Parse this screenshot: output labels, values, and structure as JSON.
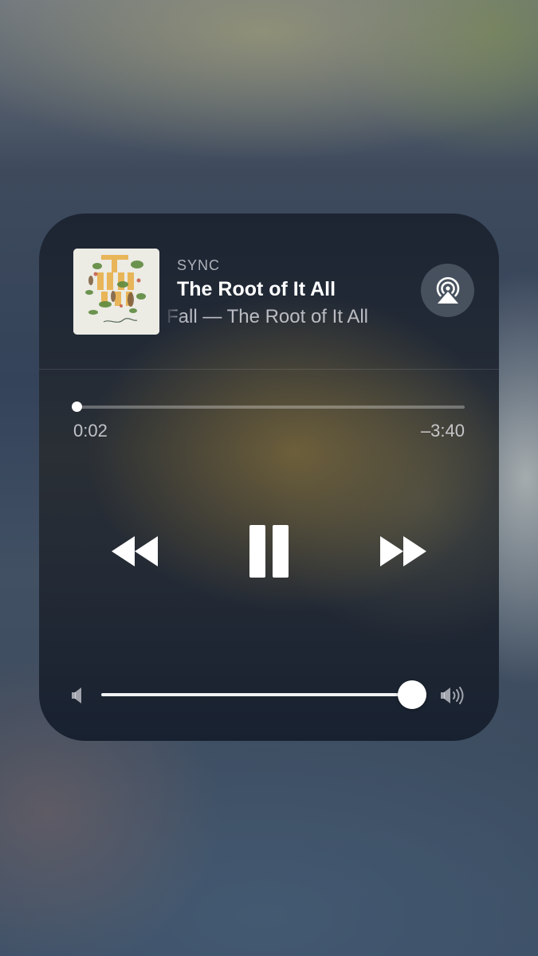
{
  "now_playing": {
    "app_name": "SYNC",
    "title": "The Root of It All",
    "artist_album": "Fall — The Root of It All"
  },
  "playback": {
    "elapsed": "0:02",
    "remaining": "–3:40",
    "progress_fraction": 0.009
  },
  "volume": {
    "level_fraction": 0.955
  },
  "icons": {
    "airplay": "airplay-icon",
    "rewind": "rewind-icon",
    "pause": "pause-icon",
    "forward": "fast-forward-icon",
    "volume_low": "speaker-low-icon",
    "volume_high": "speaker-high-icon"
  },
  "colors": {
    "album_text": "#e8b04a",
    "panel_dark": "#1d2533",
    "accent_white": "#ffffff"
  }
}
